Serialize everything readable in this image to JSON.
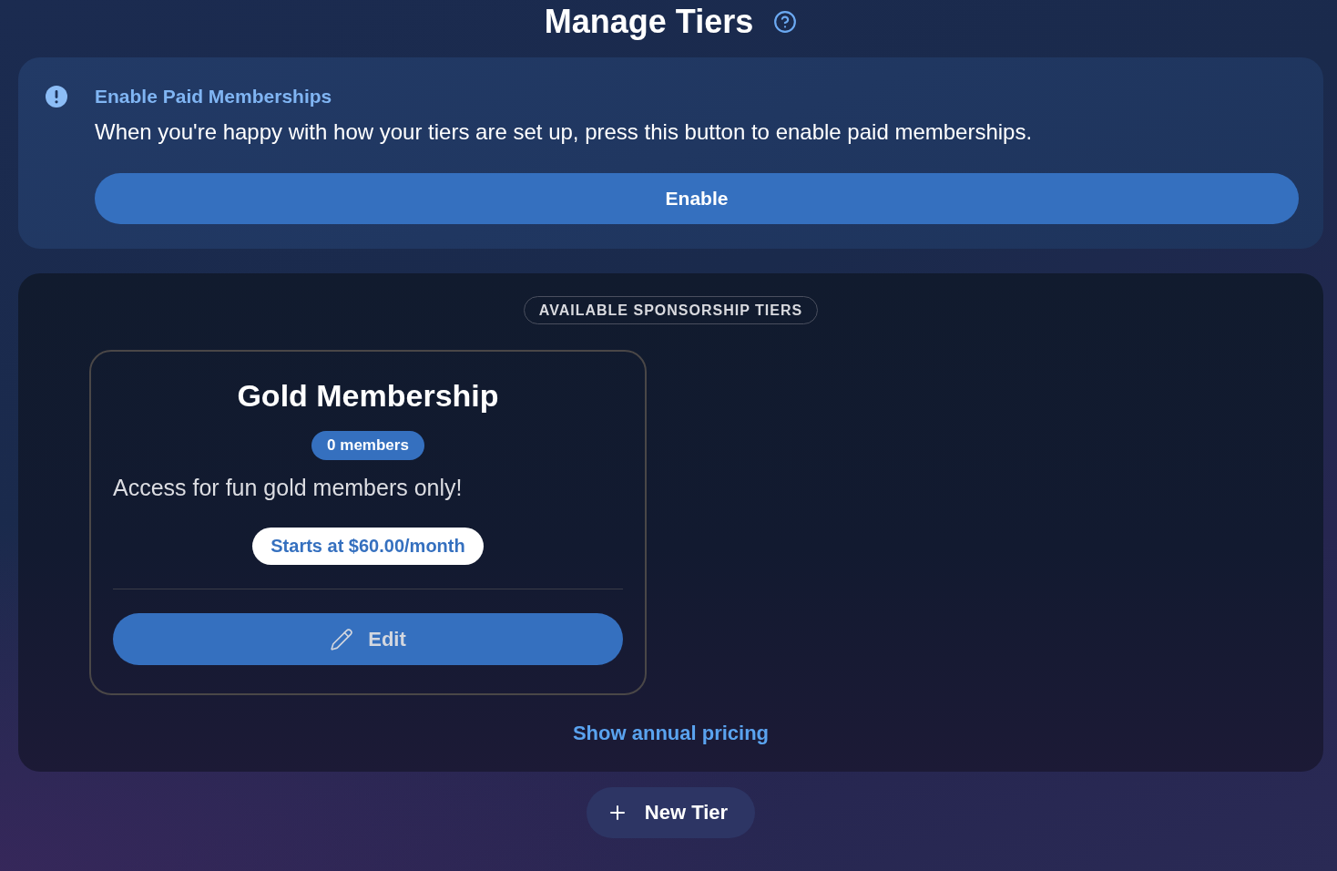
{
  "page": {
    "title": "Manage Tiers"
  },
  "notice": {
    "title": "Enable Paid Memberships",
    "message": "When you're happy with how your tiers are set up, press this button to enable paid memberships.",
    "button": "Enable"
  },
  "tiers_panel": {
    "heading": "AVAILABLE SPONSORSHIP TIERS",
    "tiers": [
      {
        "name": "Gold Membership",
        "members": "0 members",
        "description": "Access for fun gold members only!",
        "price": "Starts at $60.00/month",
        "edit_button": "Edit"
      }
    ],
    "annual_pricing_link": "Show annual pricing"
  },
  "new_tier_button": "New Tier"
}
